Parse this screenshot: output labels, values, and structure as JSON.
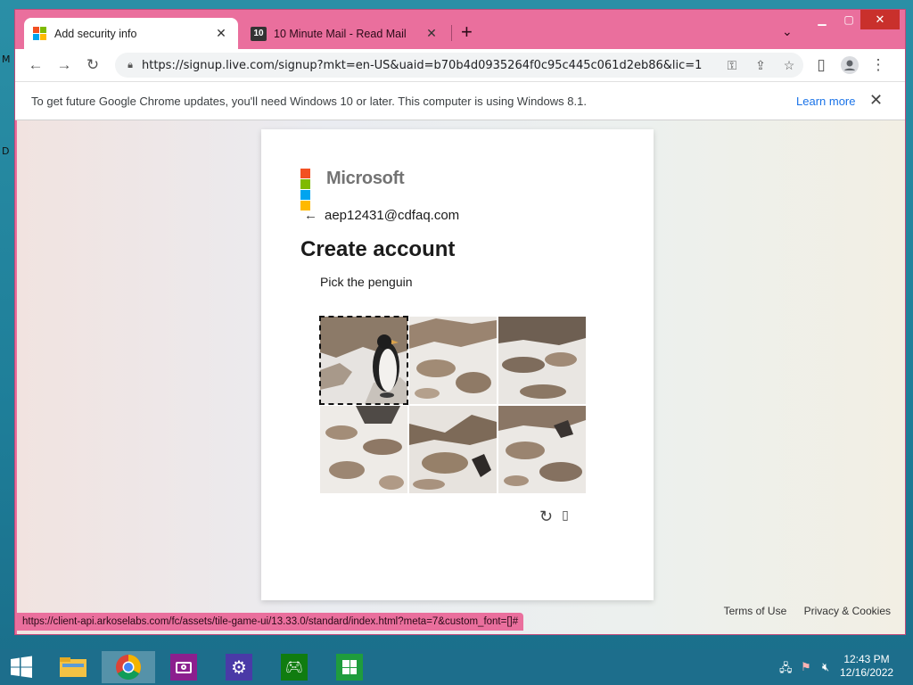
{
  "desktop": {
    "edge_letters": [
      "M",
      "D"
    ]
  },
  "browser": {
    "tabs": [
      {
        "title": "Add security info",
        "active": true,
        "favicon": "microsoft-logo"
      },
      {
        "title": "10 Minute Mail - Read Mail",
        "active": false,
        "favicon": "10-badge",
        "favicon_text": "10"
      }
    ],
    "url": "https://signup.live.com/signup?mkt=en-US&uaid=b70b4d0935264f0c95c445c061d2eb86&lic=1",
    "infobar": {
      "message": "To get future Google Chrome updates, you'll need Windows 10 or later. This computer is using Windows 8.1.",
      "link": "Learn more"
    },
    "status_url": "https://client-api.arkoselabs.com/fc/assets/tile-game-ui/13.33.0/standard/index.html?meta=7&custom_font=[]#"
  },
  "signup": {
    "brand": "Microsoft",
    "email": "aep12431@cdfaq.com",
    "heading": "Create account",
    "prompt": "Pick the penguin",
    "tiles": [
      {
        "id": 1,
        "selected": true,
        "content": "penguin"
      },
      {
        "id": 2,
        "selected": false,
        "content": "rocks"
      },
      {
        "id": 3,
        "selected": false,
        "content": "rocks"
      },
      {
        "id": 4,
        "selected": false,
        "content": "rocks"
      },
      {
        "id": 5,
        "selected": false,
        "content": "rocks"
      },
      {
        "id": 6,
        "selected": false,
        "content": "rocks"
      }
    ]
  },
  "footer": {
    "terms": "Terms of Use",
    "privacy": "Privacy & Cookies"
  },
  "taskbar": {
    "apps": [
      "file-explorer",
      "chrome",
      "camera",
      "settings",
      "xbox",
      "store"
    ],
    "time": "12:43 PM",
    "date": "12/16/2022"
  },
  "colors": {
    "chrome_frame": "#ea6f9d",
    "ms_red": "#f25022",
    "ms_green": "#7fba00",
    "ms_blue": "#00a4ef",
    "ms_yellow": "#ffb900",
    "taskbar": "#1d6e8c"
  }
}
